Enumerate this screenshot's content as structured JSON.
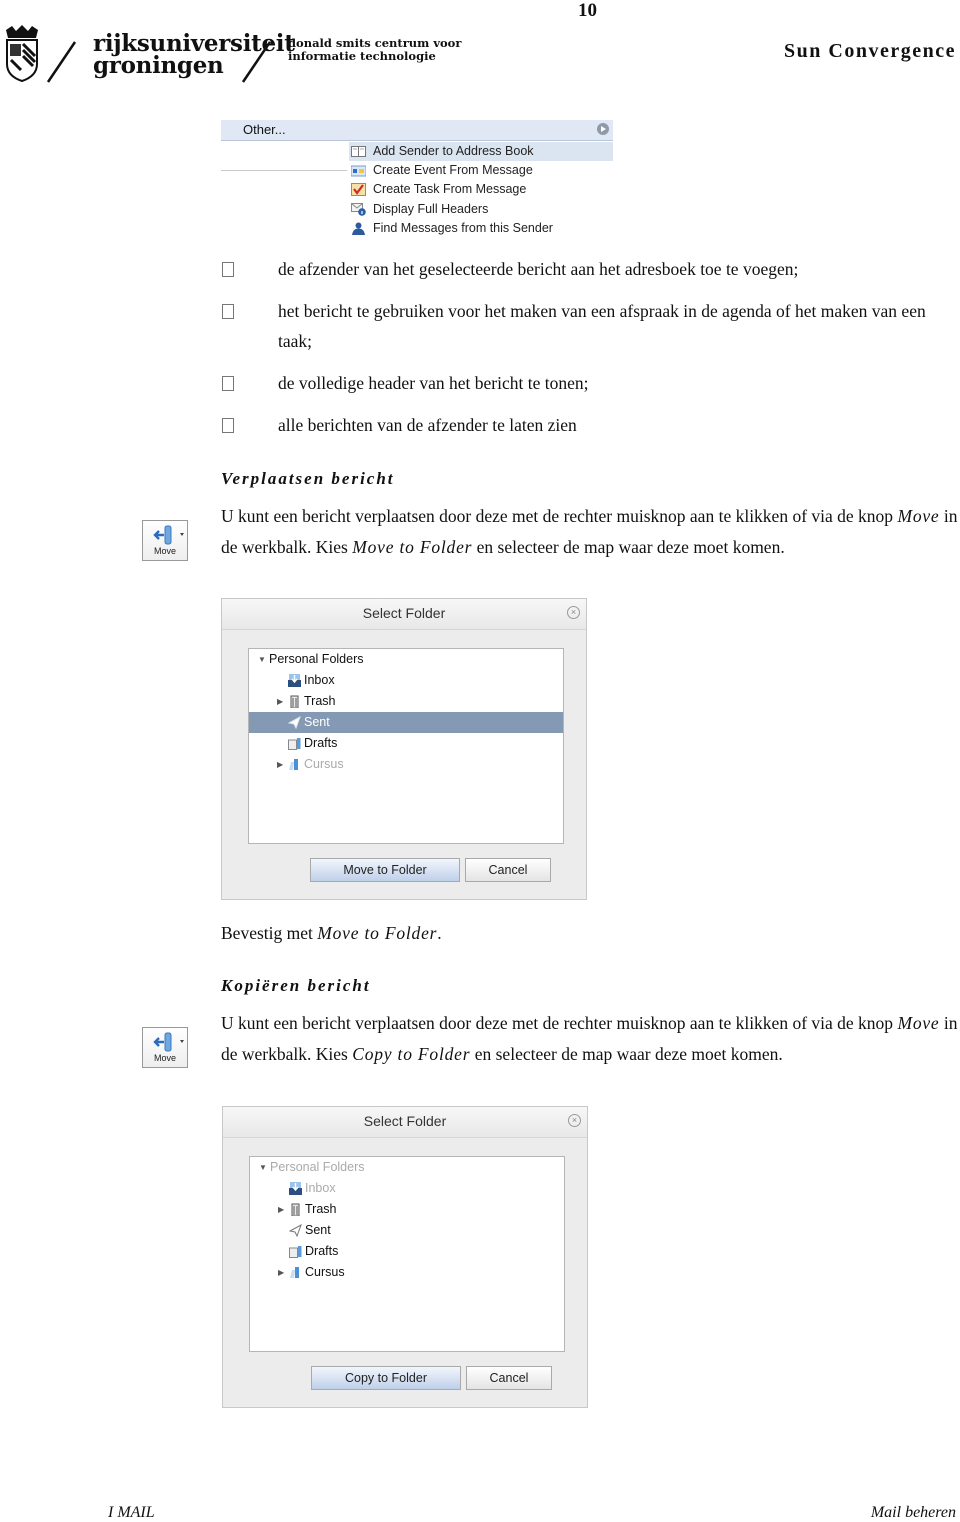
{
  "header": {
    "page_number": "10",
    "title": "Sun Convergence",
    "logo": {
      "university_line1": "rijksuniversiteit",
      "university_line2": "groningen",
      "centre_line1": "donald smits centrum voor",
      "centre_line2": "informatie technologie"
    }
  },
  "context_menu": {
    "other_label": "Other...",
    "items": [
      {
        "label": "Add Sender to Address Book",
        "icon": "address-book-icon",
        "highlighted": true
      },
      {
        "label": "Create Event From Message",
        "icon": "calendar-event-icon",
        "highlighted": false
      },
      {
        "label": "Create Task From Message",
        "icon": "task-icon",
        "highlighted": false
      },
      {
        "label": "Display Full Headers",
        "icon": "headers-info-icon",
        "highlighted": false
      },
      {
        "label": "Find Messages from this Sender",
        "icon": "person-icon",
        "highlighted": false
      }
    ]
  },
  "bullets": [
    {
      "text": "de afzender van het geselecteerde bericht aan het adresboek toe te voegen;"
    },
    {
      "text": "het bericht te gebruiken voor het maken van een afspraak in de agenda of het maken van een taak;"
    },
    {
      "text": "de volledige header van het bericht te tonen;"
    },
    {
      "text": "alle berichten van de afzender te laten zien"
    }
  ],
  "move_section": {
    "title": "Verplaatsen bericht",
    "toolbar_button_label": "Move",
    "para_part1": "U kunt een bericht verplaatsen door deze met de rechter muisknop aan te klikken of via de knop ",
    "para_em1": "Move",
    "para_part2": " in de werkbalk. Kies ",
    "para_em2": "Move to Folder",
    "para_part3": " en selecteer de map waar deze moet komen.",
    "confirm_prefix": "Bevestig met ",
    "confirm_em": "Move to Folder",
    "confirm_suffix": "."
  },
  "dialog_move": {
    "title": "Select Folder",
    "close_glyph": "×",
    "folders": [
      {
        "label": "Personal Folders",
        "level": 0,
        "expander": "expanded",
        "state": "normal",
        "icon": ""
      },
      {
        "label": "Inbox",
        "level": 1,
        "expander": "",
        "state": "normal",
        "icon": "inbox-icon"
      },
      {
        "label": "Trash",
        "level": 1,
        "expander": "collapsed",
        "state": "normal",
        "icon": "trash-icon"
      },
      {
        "label": "Sent",
        "level": 1,
        "expander": "",
        "state": "selected",
        "icon": "sent-icon"
      },
      {
        "label": "Drafts",
        "level": 1,
        "expander": "",
        "state": "normal",
        "icon": "drafts-icon"
      },
      {
        "label": "Cursus",
        "level": 1,
        "expander": "collapsed",
        "state": "disabled",
        "icon": "folder-icon"
      }
    ],
    "primary_button": "Move to Folder",
    "cancel_button": "Cancel"
  },
  "copy_section": {
    "title": "Kopiëren bericht",
    "toolbar_button_label": "Move",
    "para_part1": "U kunt een bericht verplaatsen door deze met de rechter muisknop aan te klikken of via de knop ",
    "para_em1": "Move",
    "para_part2": " in de werkbalk. Kies ",
    "para_em2": "Copy to Folder",
    "para_part3": " en selecteer de map waar deze moet komen."
  },
  "dialog_copy": {
    "title": "Select Folder",
    "close_glyph": "×",
    "folders": [
      {
        "label": "Personal Folders",
        "level": 0,
        "expander": "expanded",
        "state": "disabled",
        "icon": ""
      },
      {
        "label": "Inbox",
        "level": 1,
        "expander": "",
        "state": "disabled",
        "icon": "inbox-icon"
      },
      {
        "label": "Trash",
        "level": 1,
        "expander": "collapsed",
        "state": "normal",
        "icon": "trash-icon"
      },
      {
        "label": "Sent",
        "level": 1,
        "expander": "",
        "state": "normal",
        "icon": "sent-icon"
      },
      {
        "label": "Drafts",
        "level": 1,
        "expander": "",
        "state": "normal",
        "icon": "drafts-icon"
      },
      {
        "label": "Cursus",
        "level": 1,
        "expander": "collapsed",
        "state": "normal",
        "icon": "folder-icon"
      }
    ],
    "primary_button": "Copy to Folder",
    "cancel_button": "Cancel"
  },
  "footer": {
    "left": "I MAIL",
    "right": "Mail beheren"
  }
}
